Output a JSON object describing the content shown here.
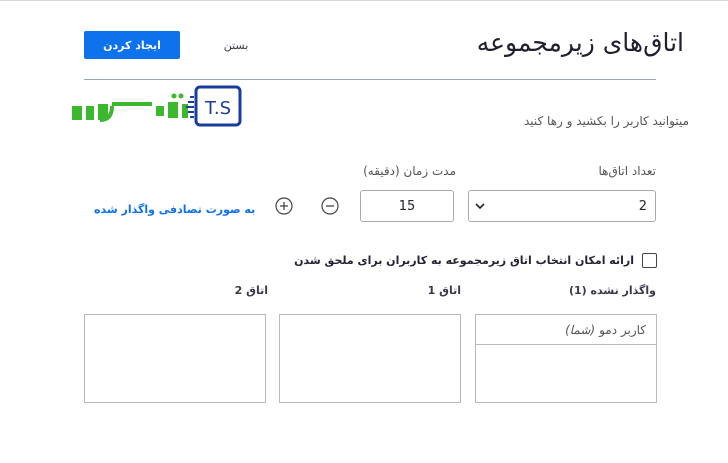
{
  "header": {
    "title": "اتاق‌های زیرمجموعه",
    "create_label": "ایجاد کردن",
    "close_label": "بستن"
  },
  "logo": {
    "text": "تهران سرور",
    "badge": "T.S"
  },
  "hint": "میتوانید کاربر را بکشید و رها کنید",
  "rooms_count": {
    "label": "تعداد اتاق‌ها",
    "value": "2"
  },
  "duration": {
    "label": "مدت زمان (دقیقه)",
    "value": "15"
  },
  "random_assign_label": "به صورت تصادفی واگذار شده",
  "allow_choose": {
    "label": "ارائه امکان انتخاب اتاق زیرمجموعه به کاربران برای ملحق شدن",
    "checked": false
  },
  "columns": [
    {
      "title": "واگذار نشده (1)",
      "users": [
        {
          "name": "کاربر دمو",
          "tag": "(شما)"
        }
      ]
    },
    {
      "title": "اتاق 1",
      "users": []
    },
    {
      "title": "اتاق 2",
      "users": []
    }
  ],
  "colors": {
    "accent": "#0e72ed",
    "logo_green": "#3cb82e",
    "logo_blue": "#1a3d9c"
  }
}
